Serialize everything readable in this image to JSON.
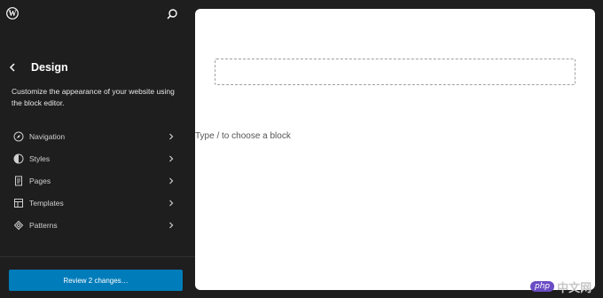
{
  "sidebar": {
    "title": "Design",
    "description": "Customize the appearance of your website using the block editor.",
    "items": [
      {
        "label": "Navigation",
        "icon": "navigation-icon"
      },
      {
        "label": "Styles",
        "icon": "styles-icon"
      },
      {
        "label": "Pages",
        "icon": "pages-icon"
      },
      {
        "label": "Templates",
        "icon": "templates-icon"
      },
      {
        "label": "Patterns",
        "icon": "patterns-icon"
      }
    ],
    "review_button": "Review 2 changes…"
  },
  "canvas": {
    "block_prompt": "Type / to choose a block"
  },
  "watermark": {
    "logo": "php",
    "text": "中文网"
  },
  "colors": {
    "sidebar_bg": "#1e1e1e",
    "accent": "#007cba",
    "canvas_bg": "#ffffff"
  }
}
